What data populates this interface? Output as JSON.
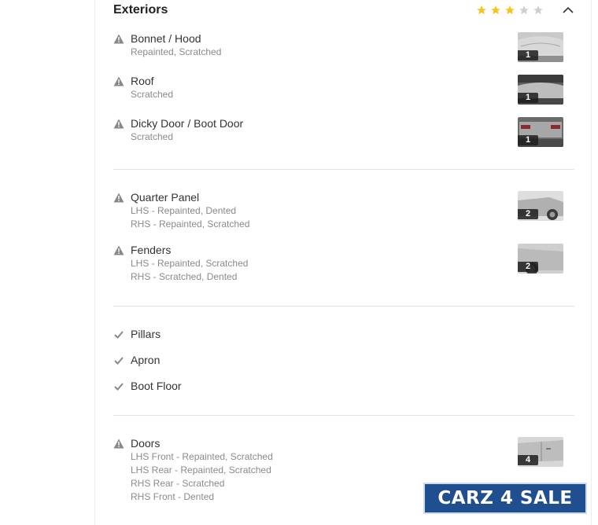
{
  "section": {
    "title": "Exteriors",
    "rating": 3,
    "rating_max": 5,
    "star_filled_color": "#f5c518",
    "star_empty_color": "#cfcfcf"
  },
  "groups": [
    {
      "items": [
        {
          "name": "Bonnet / Hood",
          "details": [
            "Repainted, Scratched"
          ],
          "status": "warning",
          "photo_count": "1"
        },
        {
          "name": "Roof",
          "details": [
            "Scratched"
          ],
          "status": "warning",
          "photo_count": "1"
        },
        {
          "name": "Dicky Door / Boot Door",
          "details": [
            "Scratched"
          ],
          "status": "warning",
          "photo_count": "1"
        }
      ]
    },
    {
      "items": [
        {
          "name": "Quarter Panel",
          "details": [
            "LHS - Repainted, Dented",
            "RHS - Repainted, Scratched"
          ],
          "status": "warning",
          "photo_count": "2"
        },
        {
          "name": "Fenders",
          "details": [
            "LHS - Repainted, Scratched",
            "RHS - Scratched, Dented"
          ],
          "status": "warning",
          "photo_count": "2"
        }
      ]
    },
    {
      "items": [
        {
          "name": "Pillars",
          "status": "ok"
        },
        {
          "name": "Apron",
          "status": "ok"
        },
        {
          "name": "Boot Floor",
          "status": "ok"
        }
      ]
    },
    {
      "items": [
        {
          "name": "Doors",
          "details": [
            "LHS Front - Repainted, Scratched",
            "LHS Rear - Repainted, Scratched",
            "RHS Rear - Scratched",
            "RHS Front - Dented"
          ],
          "status": "warning",
          "photo_count": "4"
        }
      ]
    }
  ],
  "watermark": {
    "text": "CARZ 4 SALE"
  }
}
